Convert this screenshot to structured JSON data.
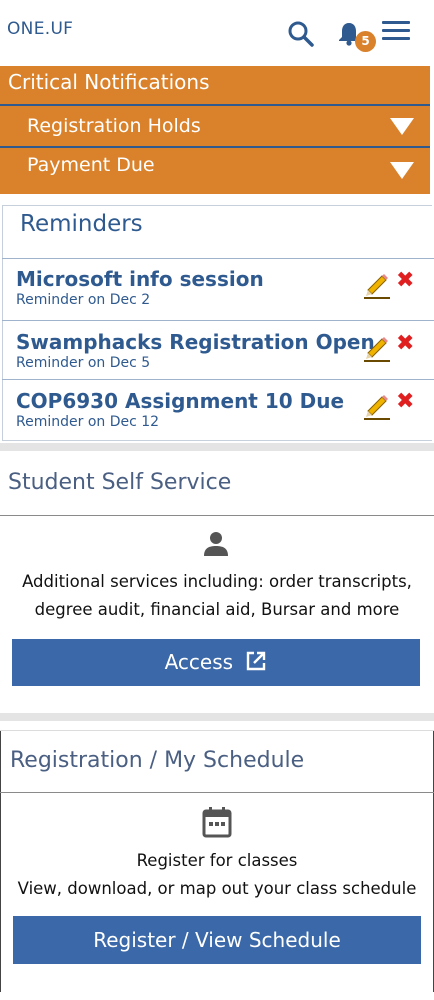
{
  "header": {
    "brand": "ONE.UF",
    "notification_count": "5",
    "icons": [
      "search-icon",
      "bell-icon",
      "hamburger-menu-icon"
    ]
  },
  "critical": {
    "title": "Critical Notifications",
    "items": [
      {
        "label": "Registration Holds"
      },
      {
        "label": "Payment Due"
      }
    ]
  },
  "reminders": {
    "title": "Reminders",
    "items": [
      {
        "name": "Microsoft info session",
        "date": "Reminder on Dec 2"
      },
      {
        "name": "Swamphacks Registration Open",
        "date": "Reminder on Dec 5"
      },
      {
        "name": "COP6930 Assignment 10 Due",
        "date": "Reminder on Dec 12"
      }
    ]
  },
  "self_service": {
    "title": "Student Self Service",
    "desc_line1": "Additional services including: order transcripts,",
    "desc_line2": "degree audit, financial aid, Bursar and more",
    "button": "Access"
  },
  "registration": {
    "title": "Registration / My Schedule",
    "desc_line1": "Register for classes",
    "desc_line2": "View, download, or map out your class schedule",
    "button": "Register / View Schedule"
  },
  "colors": {
    "brand_blue": "#2f5a8f",
    "accent_orange": "#d9822b",
    "button_blue": "#3a68a8",
    "delete_red": "#e02020"
  }
}
